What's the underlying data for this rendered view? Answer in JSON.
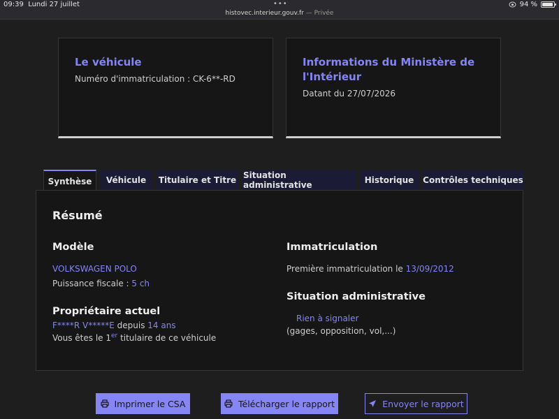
{
  "status_bar": {
    "time": "09:39",
    "date": "Lundi 27 juillet",
    "dots": "•••",
    "url": "histovec.interieur.gouv.fr",
    "private_label": "— Privée",
    "battery": "94 %",
    "battery_level": 0.94
  },
  "cards": {
    "vehicle": {
      "title": "Le véhicule",
      "text": "Numéro d'immatriculation : CK-6**-RD"
    },
    "ministry": {
      "title_line1": "Informations du Ministère de",
      "title_line2": "l'Intérieur",
      "text": "Datant du 27/07/2026"
    }
  },
  "tabs": [
    "Synthèse",
    "Véhicule",
    "Titulaire et Titre",
    "Situation administrative",
    "Historique",
    "Contrôles techniques"
  ],
  "summary": {
    "heading": "Résumé",
    "model": {
      "heading": "Modèle",
      "name": "VOLKSWAGEN POLO",
      "power_label": "Puissance fiscale : ",
      "power_value": "5 ch"
    },
    "owner": {
      "heading": "Propriétaire actuel",
      "name": "F****R V*****E",
      "since_label": " depuis ",
      "since_value": "14 ans",
      "holder_prefix": "Vous êtes le 1",
      "holder_sup": "er",
      "holder_suffix": " titulaire de ce véhicule"
    },
    "registration": {
      "heading": "Immatriculation",
      "first_label": "Première immatriculation le ",
      "first_date": "13/09/2012"
    },
    "admin": {
      "heading": "Situation administrative",
      "status": "Rien à signaler",
      "details": "(gages, opposition, vol,...)"
    }
  },
  "actions": {
    "print": "Imprimer le CSA",
    "download": "Télécharger le rapport",
    "send": "Envoyer le rapport"
  }
}
